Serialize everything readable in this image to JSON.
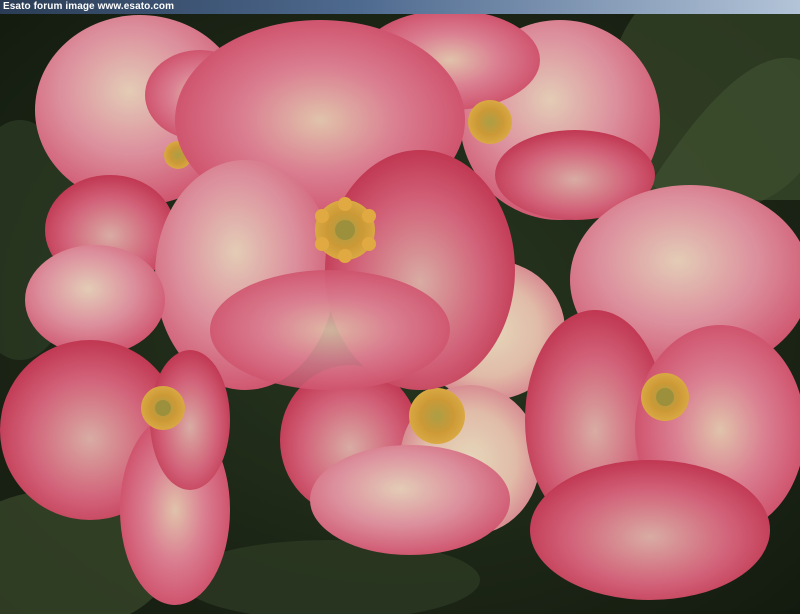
{
  "watermark": {
    "text": "Esato forum image www.esato.com"
  },
  "photo": {
    "subject": "crown-of-thorns-flowers",
    "colors": {
      "background_leaf": "#2a3b22",
      "background_dark": "#141c10",
      "petal_pink": "#e05a76",
      "petal_cream": "#efd6b6",
      "petal_deep": "#c9304e",
      "center_yellow": "#e1aa3a",
      "center_green": "#a8a84a"
    }
  }
}
